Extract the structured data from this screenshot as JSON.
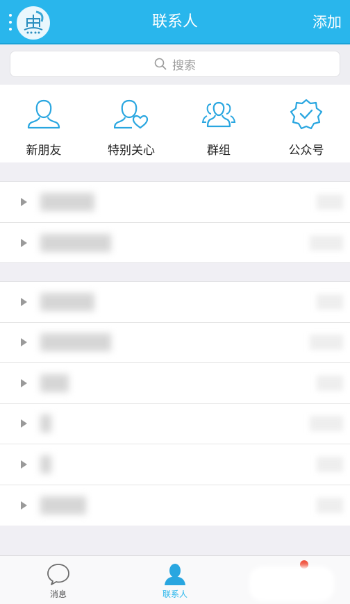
{
  "header": {
    "title": "联系人",
    "add_label": "添加",
    "avatar_icon": "fish-logo-icon",
    "accent": "#29b6ec"
  },
  "search": {
    "placeholder": "搜索",
    "icon": "search-icon"
  },
  "quick_actions": [
    {
      "label": "新朋友",
      "icon": "person-icon"
    },
    {
      "label": "特别关心",
      "icon": "person-heart-icon"
    },
    {
      "label": "群组",
      "icon": "group-icon"
    },
    {
      "label": "公众号",
      "icon": "verified-badge-icon"
    }
  ],
  "groups_top": [
    {
      "name": "██████",
      "count": "██"
    },
    {
      "name": "████████",
      "count": "███"
    }
  ],
  "groups_bottom": [
    {
      "name": "██████",
      "count": "██"
    },
    {
      "name": "████████",
      "count": "███"
    },
    {
      "name": "███",
      "count": "██"
    },
    {
      "name": "█",
      "count": "███"
    },
    {
      "name": "█",
      "count": "██"
    },
    {
      "name": "█████",
      "count": "██"
    }
  ],
  "tabbar": {
    "messages_label": "消息",
    "contacts_label": "联系人"
  }
}
